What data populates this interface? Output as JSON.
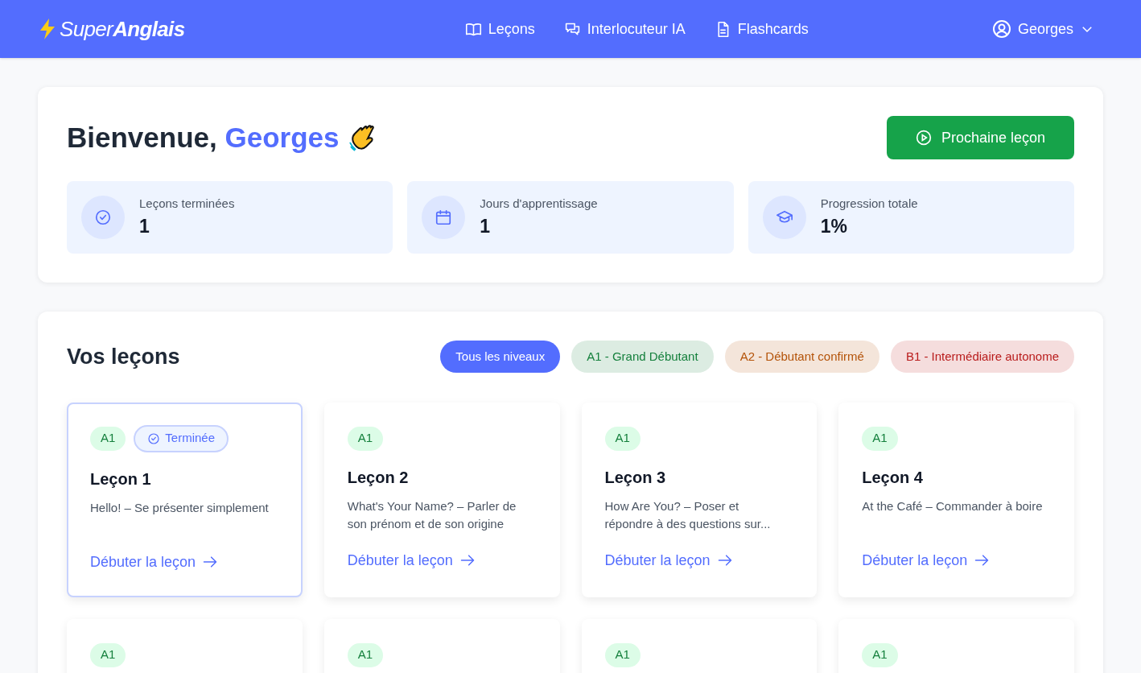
{
  "nav": {
    "logo": "Super**Anglais**",
    "links": [
      {
        "label": "Leçons"
      },
      {
        "label": "Interlocuteur IA"
      },
      {
        "label": "Flashcards"
      }
    ],
    "user": "Georges"
  },
  "welcome": {
    "greeting": "Bienvenue,",
    "name": "Georges",
    "button": "Prochaine leçon",
    "stats": [
      {
        "label": "Leçons terminées",
        "value": "1"
      },
      {
        "label": "Jours d'apprentissage",
        "value": "1"
      },
      {
        "label": "Progression totale",
        "value": "1%"
      }
    ]
  },
  "lessons": {
    "title": "Vos leçons",
    "filters": [
      {
        "label": "Tous les niveaux",
        "selected": true,
        "color": "#536dfe"
      },
      {
        "label": "A1 - Grand Débutant",
        "selected": false,
        "color": "#15803d"
      },
      {
        "label": "A2 - Débutant confirmé",
        "selected": false,
        "color": "#b45309"
      },
      {
        "label": "B1 - Intermédiaire autonome",
        "selected": false,
        "color": "#b91c1c"
      }
    ],
    "cards": [
      {
        "level": "A1",
        "completed": true,
        "status_label": "Terminée",
        "title": "Leçon 1",
        "description": "Hello! – Se présenter simplement",
        "link": "Débuter la leçon"
      },
      {
        "level": "A1",
        "completed": false,
        "title": "Leçon 2",
        "description": "What's Your Name? – Parler de son prénom et de son origine",
        "link": "Débuter la leçon"
      },
      {
        "level": "A1",
        "completed": false,
        "title": "Leçon 3",
        "description": "How Are You? – Poser et répondre à des questions sur...",
        "link": "Débuter la leçon"
      },
      {
        "level": "A1",
        "completed": false,
        "title": "Leçon 4",
        "description": "At the Café – Commander à boire",
        "link": "Débuter la leçon"
      },
      {
        "level": "A1",
        "completed": false
      },
      {
        "level": "A1",
        "completed": false
      },
      {
        "level": "A1",
        "completed": false
      },
      {
        "level": "A1",
        "completed": false
      }
    ]
  }
}
